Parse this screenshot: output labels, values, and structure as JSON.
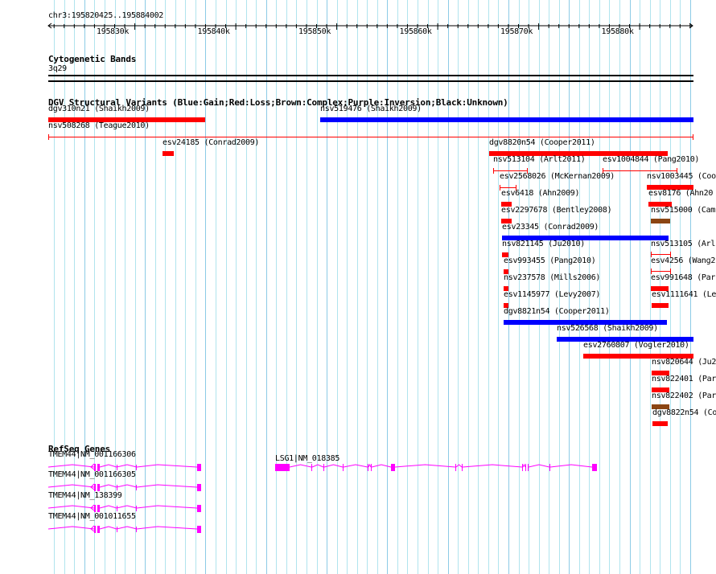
{
  "ruler": {
    "region": "chr3:195820425..195884002",
    "ticks": [
      "195830k",
      "195840k",
      "195850k",
      "195860k",
      "195870k",
      "195880k"
    ]
  },
  "cytobands": {
    "title": "Cytogenetic Bands",
    "band": "3q29"
  },
  "dgv": {
    "title": "DGV Structural Variants (Blue:Gain;Red:Loss;Brown:Complex;Purple:Inversion;Black:Unknown)",
    "colors": {
      "gain": "#0000ff",
      "loss": "#ff0000",
      "complex": "#8b4513"
    },
    "features": [
      {
        "label": "dgv310n21 (Shaikh2009)",
        "type": "loss"
      },
      {
        "label": "nsv519476 (Shaikh2009)",
        "type": "gain"
      },
      {
        "label": "nsv508268 (Teague2010)",
        "type": "loss"
      },
      {
        "label": "esv24185 (Conrad2009)",
        "type": "loss"
      },
      {
        "label": "dgv8820n54 (Cooper2011)",
        "type": "loss"
      },
      {
        "label": "nsv513104 (Arlt2011)",
        "type": "loss"
      },
      {
        "label": "esv1004844 (Pang2010)",
        "type": "loss"
      },
      {
        "label": "esv2568026 (McKernan2009)",
        "type": "loss"
      },
      {
        "label": "nsv1003445 (Coo",
        "type": "loss"
      },
      {
        "label": "esv6418 (Ahn2009)",
        "type": "loss"
      },
      {
        "label": "esv8176 (Ahn20",
        "type": "loss"
      },
      {
        "label": "esv2297678 (Bentley2008)",
        "type": "loss"
      },
      {
        "label": "nsv515000 (Cam",
        "type": "complex"
      },
      {
        "label": "esv23345 (Conrad2009)",
        "type": "gain"
      },
      {
        "label": "nsv821145 (Ju2010)",
        "type": "loss"
      },
      {
        "label": "nsv513105 (Arl",
        "type": "loss"
      },
      {
        "label": "esv993455 (Pang2010)",
        "type": "loss"
      },
      {
        "label": "esv4256 (Wang2",
        "type": "loss"
      },
      {
        "label": "nsv237578 (Mills2006)",
        "type": "loss"
      },
      {
        "label": "esv991648 (Par",
        "type": "loss"
      },
      {
        "label": "esv1145977 (Levy2007)",
        "type": "loss"
      },
      {
        "label": "esv1111641 (Le",
        "type": "loss"
      },
      {
        "label": "dgv8821n54 (Cooper2011)",
        "type": "gain"
      },
      {
        "label": "nsv526568 (Shaikh2009)",
        "type": "gain"
      },
      {
        "label": "esv2760807 (Vogler2010)",
        "type": "loss"
      },
      {
        "label": "nsv820644 (Ju2",
        "type": "loss"
      },
      {
        "label": "nsv822401 (Par",
        "type": "loss"
      },
      {
        "label": "nsv822402 (Par",
        "type": "complex"
      },
      {
        "label": "dgv8822n54 (Co",
        "type": "loss"
      }
    ]
  },
  "refseq": {
    "title": "RefSeq Genes",
    "color": "#ff00ff",
    "genes": [
      {
        "label": "TMEM44|NM_001166306"
      },
      {
        "label": "TMEM44|NM_001166305"
      },
      {
        "label": "TMEM44|NM_138399"
      },
      {
        "label": "TMEM44|NM_001011655"
      },
      {
        "label": "LSG1|NM_018385"
      }
    ]
  }
}
